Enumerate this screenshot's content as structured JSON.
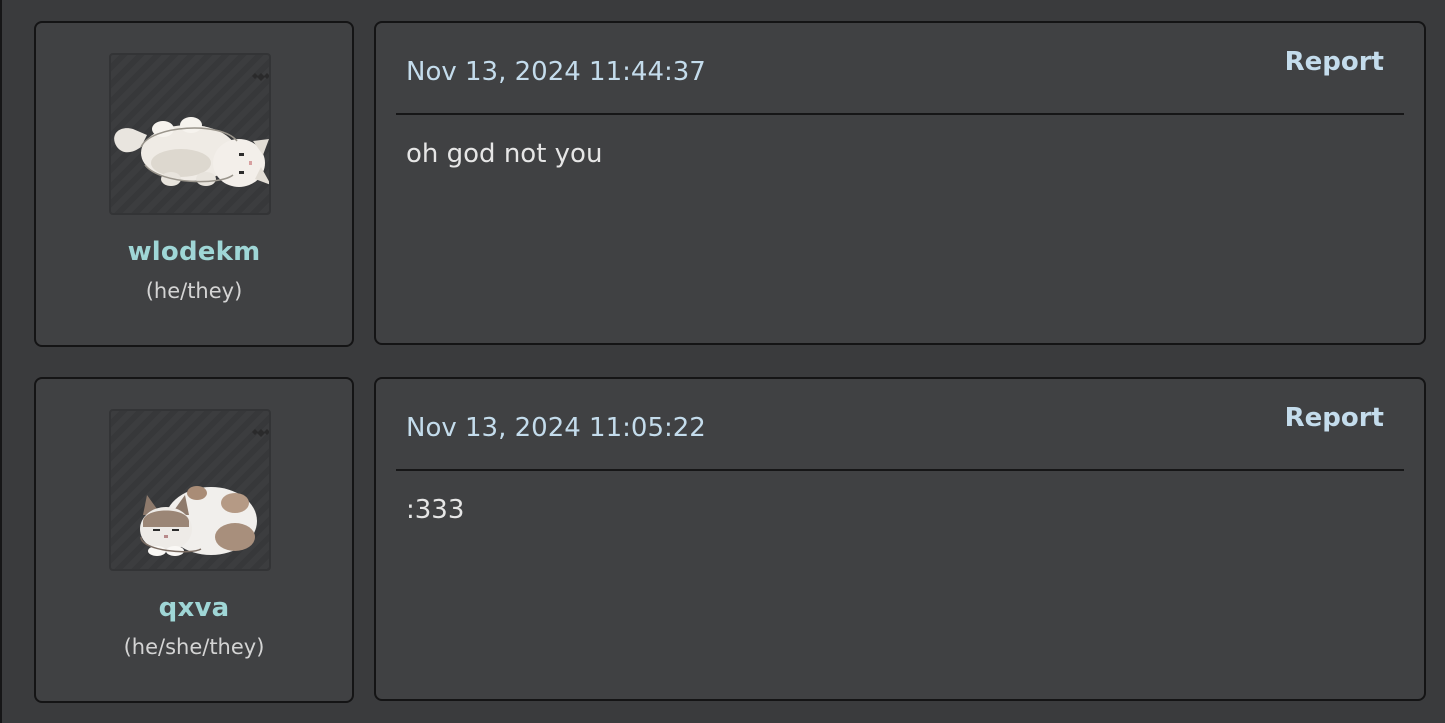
{
  "posts": [
    {
      "username": "wlodekm",
      "pronouns": "(he/they)",
      "timestamp": "Nov 13, 2024 11:44:37",
      "report_label": "Report",
      "message": "oh god not you",
      "avatar_icon": "white-cat-lying-on-back-icon"
    },
    {
      "username": "qxva",
      "pronouns": "(he/she/they)",
      "timestamp": "Nov 13, 2024 11:05:22",
      "report_label": "Report",
      "message": ":333",
      "avatar_icon": "calico-cat-curled-up-icon"
    }
  ],
  "colors": {
    "background": "#3a3b3d",
    "card": "#404143",
    "border": "#141415",
    "username": "#9fd6d6",
    "link": "#c4dcec",
    "text": "#e6e6e6"
  }
}
